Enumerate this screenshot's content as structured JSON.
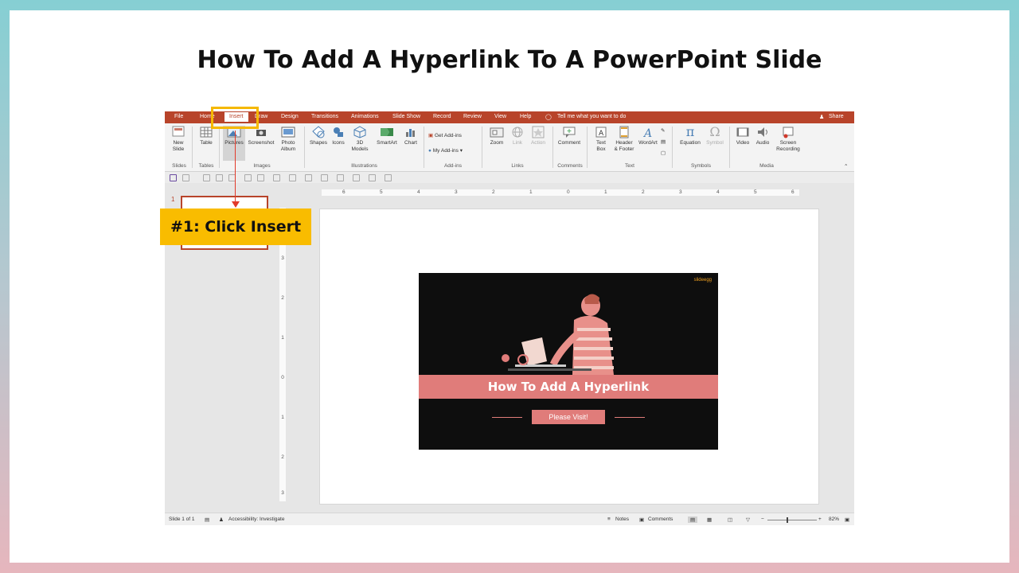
{
  "page_title": "How To Add A Hyperlink To A PowerPoint Slide",
  "callout": "#1: Click Insert",
  "ppt": {
    "tabs": [
      "File",
      "Home",
      "Insert",
      "Draw",
      "Design",
      "Transitions",
      "Animations",
      "Slide Show",
      "Record",
      "Review",
      "View",
      "Help"
    ],
    "active_tab": "Insert",
    "tell_me": "Tell me what you want to do",
    "share": "Share",
    "ribbon": {
      "new_slide": [
        "New",
        "Slide"
      ],
      "table": "Table",
      "pictures": "Pictures",
      "screenshot": "Screenshot",
      "photo_album": [
        "Photo",
        "Album"
      ],
      "shapes": "Shapes",
      "icons": "Icons",
      "models": [
        "3D",
        "Models"
      ],
      "smartart": "SmartArt",
      "chart": "Chart",
      "get_addins": "Get Add-ins",
      "my_addins": "My Add-ins",
      "zoom": "Zoom",
      "link": "Link",
      "action": "Action",
      "comment": "Comment",
      "text_box": [
        "Text",
        "Box"
      ],
      "header_footer": [
        "Header",
        "& Footer"
      ],
      "wordart": "WordArt",
      "equation": "Equation",
      "symbol": "Symbol",
      "video": "Video",
      "audio": "Audio",
      "screen_recording": [
        "Screen",
        "Recording"
      ]
    },
    "groups": [
      "Slides",
      "Tables",
      "Images",
      "Illustrations",
      "Add-ins",
      "Links",
      "Comments",
      "Text",
      "Symbols",
      "Media"
    ],
    "slide_number": "1",
    "ruler_h": [
      "6",
      "5",
      "4",
      "3",
      "2",
      "1",
      "0",
      "1",
      "2",
      "3",
      "4",
      "5",
      "6"
    ],
    "ruler_v": [
      "3",
      "2",
      "1",
      "0",
      "1",
      "2",
      "3"
    ],
    "slide": {
      "logo": "slideegg",
      "banner": "How To Add A Hyperlink",
      "button": "Please Visit!"
    },
    "status": {
      "slide_of": "Slide 1 of 1",
      "accessibility": "Accessibility: Investigate",
      "notes": "Notes",
      "comments": "Comments",
      "zoom": "82%"
    }
  },
  "colors": {
    "accent": "#b8442a",
    "highlight": "#f5b800",
    "callout": "#f9bc00",
    "arrow": "#e23a2a",
    "slide_pink": "#e07c7a",
    "slide_dark": "#0e0e0e"
  }
}
